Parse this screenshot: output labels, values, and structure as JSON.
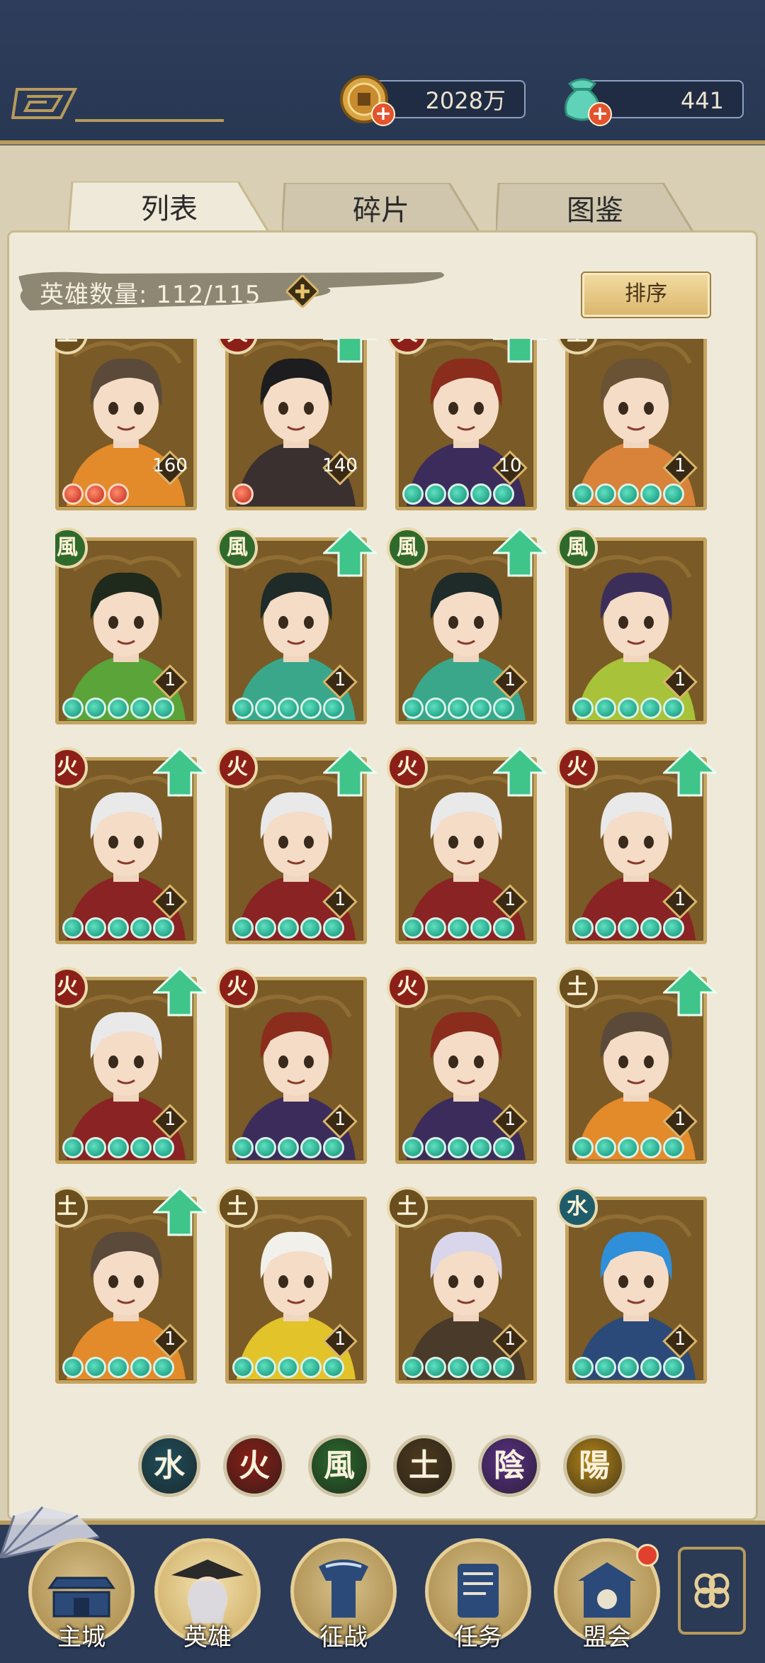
{
  "currency": {
    "coins": "2028万",
    "jade": "441"
  },
  "tabs": [
    {
      "label": "列表"
    },
    {
      "label": "碎片"
    },
    {
      "label": "图鉴"
    }
  ],
  "hero_count": {
    "label": "英雄数量:",
    "value": "112/115"
  },
  "sort_label": "排序",
  "heroes": [
    {
      "element": "土",
      "element_color": "#6b4e1e",
      "level": "160",
      "stars": 3,
      "star_type": "red",
      "upgrade": false,
      "hair": "#5b4a3a",
      "outfit": "#e38a2a"
    },
    {
      "element": "火",
      "element_color": "#8c2018",
      "level": "140",
      "stars": 1,
      "star_type": "red",
      "upgrade": true,
      "hair": "#1d1d1f",
      "outfit": "#3a3030"
    },
    {
      "element": "火",
      "element_color": "#8c2018",
      "level": "10",
      "stars": 5,
      "star_type": "green",
      "upgrade": true,
      "hair": "#8a2d1c",
      "outfit": "#3c2c5c"
    },
    {
      "element": "土",
      "element_color": "#6b4e1e",
      "level": "1",
      "stars": 5,
      "star_type": "green",
      "upgrade": false,
      "hair": "#6a5234",
      "outfit": "#d9823a"
    },
    {
      "element": "風",
      "element_color": "#2f6a2c",
      "level": "1",
      "stars": 5,
      "star_type": "green",
      "upgrade": false,
      "hair": "#1f2a1c",
      "outfit": "#5aa43a"
    },
    {
      "element": "風",
      "element_color": "#2f6a2c",
      "level": "1",
      "stars": 5,
      "star_type": "green",
      "upgrade": true,
      "hair": "#1e2b28",
      "outfit": "#3aa78a"
    },
    {
      "element": "風",
      "element_color": "#2f6a2c",
      "level": "1",
      "stars": 5,
      "star_type": "green",
      "upgrade": true,
      "hair": "#1e2b28",
      "outfit": "#3aa78a"
    },
    {
      "element": "風",
      "element_color": "#2f6a2c",
      "level": "1",
      "stars": 5,
      "star_type": "green",
      "upgrade": false,
      "hair": "#3b2f5a",
      "outfit": "#a8c23a"
    },
    {
      "element": "火",
      "element_color": "#8c2018",
      "level": "1",
      "stars": 5,
      "star_type": "green",
      "upgrade": true,
      "hair": "#e9e9ea",
      "outfit": "#8a2323"
    },
    {
      "element": "火",
      "element_color": "#8c2018",
      "level": "1",
      "stars": 5,
      "star_type": "green",
      "upgrade": true,
      "hair": "#e9e9ea",
      "outfit": "#8a2323"
    },
    {
      "element": "火",
      "element_color": "#8c2018",
      "level": "1",
      "stars": 5,
      "star_type": "green",
      "upgrade": true,
      "hair": "#e9e9ea",
      "outfit": "#8a2323"
    },
    {
      "element": "火",
      "element_color": "#8c2018",
      "level": "1",
      "stars": 5,
      "star_type": "green",
      "upgrade": true,
      "hair": "#e9e9ea",
      "outfit": "#8a2323"
    },
    {
      "element": "火",
      "element_color": "#8c2018",
      "level": "1",
      "stars": 5,
      "star_type": "green",
      "upgrade": true,
      "hair": "#e9e9ea",
      "outfit": "#8a2323"
    },
    {
      "element": "火",
      "element_color": "#8c2018",
      "level": "1",
      "stars": 5,
      "star_type": "green",
      "upgrade": false,
      "hair": "#8a2d1c",
      "outfit": "#3c2c5c"
    },
    {
      "element": "火",
      "element_color": "#8c2018",
      "level": "1",
      "stars": 5,
      "star_type": "green",
      "upgrade": false,
      "hair": "#8a2d1c",
      "outfit": "#3c2c5c"
    },
    {
      "element": "土",
      "element_color": "#6b4e1e",
      "level": "1",
      "stars": 5,
      "star_type": "green",
      "upgrade": true,
      "hair": "#5b4a3a",
      "outfit": "#e38a2a"
    },
    {
      "element": "土",
      "element_color": "#6b4e1e",
      "level": "1",
      "stars": 5,
      "star_type": "green",
      "upgrade": true,
      "hair": "#5b4a3a",
      "outfit": "#e38a2a"
    },
    {
      "element": "土",
      "element_color": "#6b4e1e",
      "level": "1",
      "stars": 5,
      "star_type": "green",
      "upgrade": false,
      "hair": "#f2f0ea",
      "outfit": "#e2c32a"
    },
    {
      "element": "土",
      "element_color": "#6b4e1e",
      "level": "1",
      "stars": 5,
      "star_type": "green",
      "upgrade": false,
      "hair": "#d9d6ec",
      "outfit": "#4a3a2a"
    },
    {
      "element": "水",
      "element_color": "#1f5c6a",
      "level": "1",
      "stars": 5,
      "star_type": "green",
      "upgrade": false,
      "hair": "#2f8fd8",
      "outfit": "#2b4a7a"
    }
  ],
  "element_filters": [
    {
      "glyph": "水",
      "color": "#1e4f5c"
    },
    {
      "glyph": "火",
      "color": "#8a1f17"
    },
    {
      "glyph": "風",
      "color": "#2b6a2c"
    },
    {
      "glyph": "土",
      "color": "#4e3a1d"
    },
    {
      "glyph": "陰",
      "color": "#5a2f86"
    },
    {
      "glyph": "陽",
      "color": "#b58516"
    }
  ],
  "nav": [
    {
      "label": "主城",
      "icon": "city-gate-icon"
    },
    {
      "label": "英雄",
      "icon": "hero-portrait-icon"
    },
    {
      "label": "征战",
      "icon": "battle-icon"
    },
    {
      "label": "任务",
      "icon": "scroll-icon"
    },
    {
      "label": "盟会",
      "icon": "guild-icon"
    }
  ],
  "colors": {
    "gold": "#b79a5c",
    "navy": "#2b3a55",
    "panel": "#efe9d9"
  }
}
